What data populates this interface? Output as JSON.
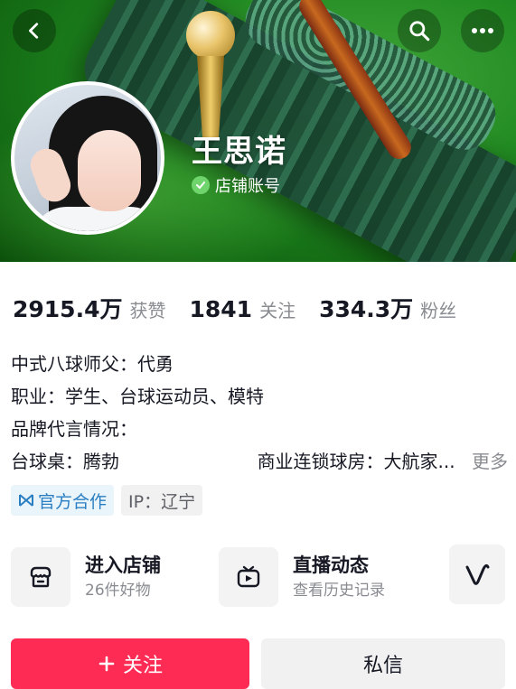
{
  "header": {
    "name": "王思诺",
    "badge_label": "店铺账号"
  },
  "stats": [
    {
      "value": "2915.4万",
      "label": "获赞"
    },
    {
      "value": "1841",
      "label": "关注"
    },
    {
      "value": "334.3万",
      "label": "粉丝"
    }
  ],
  "bio": {
    "lines": [
      "中式八球师父：代勇",
      "职业：学生、台球运动员、模特",
      "品牌代言情况："
    ],
    "last_left": "台球桌：腾勃",
    "last_right": "商业连锁球房：大航家...",
    "more_label": "更多"
  },
  "tags": {
    "official": "官方合作",
    "ip": "IP：辽宁"
  },
  "cards": {
    "store": {
      "title": "进入店铺",
      "subtitle": "26件好物"
    },
    "live": {
      "title": "直播动态",
      "subtitle": "查看历史记录"
    }
  },
  "actions": {
    "follow_label": "关注",
    "message_label": "私信"
  },
  "colors": {
    "accent": "#fe2c55",
    "banner_green": "#228b22",
    "tag_blue": "#2a7fc2"
  },
  "icons": {
    "back": "chevron-left-icon",
    "search": "search-icon",
    "more": "more-dots-icon",
    "verify": "verified-check-icon",
    "store": "store-icon",
    "live": "tv-icon",
    "v": "v-logo-icon",
    "official": "official-partner-icon",
    "follow": "plus-icon"
  }
}
